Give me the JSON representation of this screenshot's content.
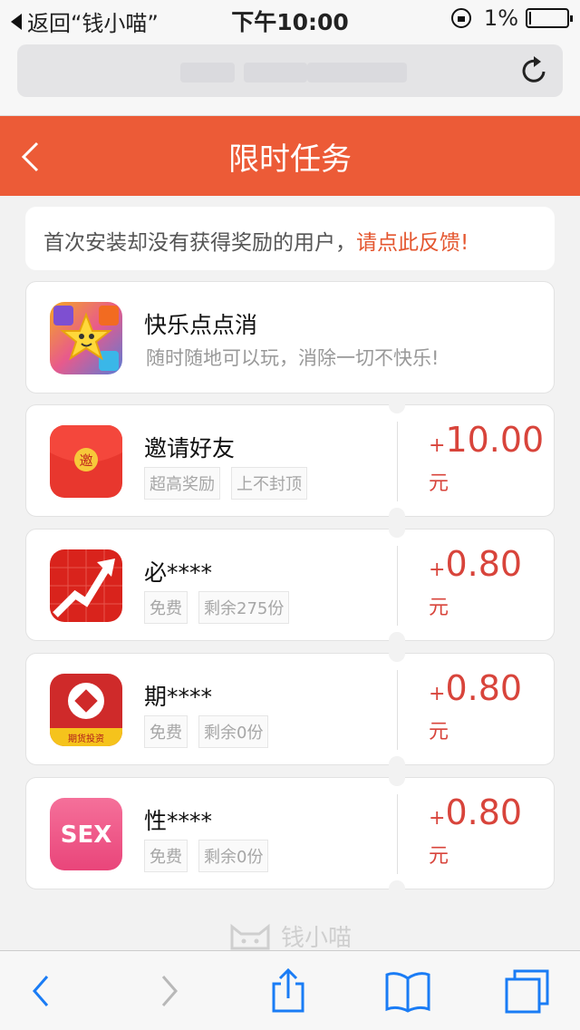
{
  "status_bar": {
    "back_app_label": "返回“钱小喵”",
    "time": "下午10:00",
    "battery_text": "1%"
  },
  "browser": {
    "url_text": "",
    "icons": [
      "reload-icon"
    ]
  },
  "header": {
    "title": "限时任务",
    "back_icon": "chevron-left-icon"
  },
  "notice": {
    "text": "首次安装却没有获得奖励的用户，",
    "link_text": "请点此反馈!"
  },
  "featured": {
    "title": "快乐点点消",
    "subtitle": "随时随地可以玩，消除一切不快乐!"
  },
  "tasks": [
    {
      "title": "邀请好友",
      "tags": [
        "超高奖励",
        "上不封顶"
      ],
      "plus": "+",
      "amount": "10.00",
      "unit": "元",
      "icon_text": "邀"
    },
    {
      "title": "必****",
      "tags": [
        "免费",
        "剩余275份"
      ],
      "plus": "+",
      "amount": "0.80",
      "unit": "元",
      "icon_text": ""
    },
    {
      "title": "期****",
      "tags": [
        "免费",
        "剩余0份"
      ],
      "plus": "+",
      "amount": "0.80",
      "unit": "元",
      "icon_text": "期货投资"
    },
    {
      "title": "性****",
      "tags": [
        "免费",
        "剩余0份"
      ],
      "plus": "+",
      "amount": "0.80",
      "unit": "元",
      "icon_text": "SEX"
    }
  ],
  "footer": {
    "brand": "钱小喵"
  },
  "toolbar": {
    "icons": [
      "back-arrow-icon",
      "forward-arrow-icon",
      "share-icon",
      "bookmarks-icon",
      "tabs-icon"
    ]
  },
  "colors": {
    "accent": "#ec5b37",
    "reward": "#d8443b",
    "link": "#e4562f"
  }
}
